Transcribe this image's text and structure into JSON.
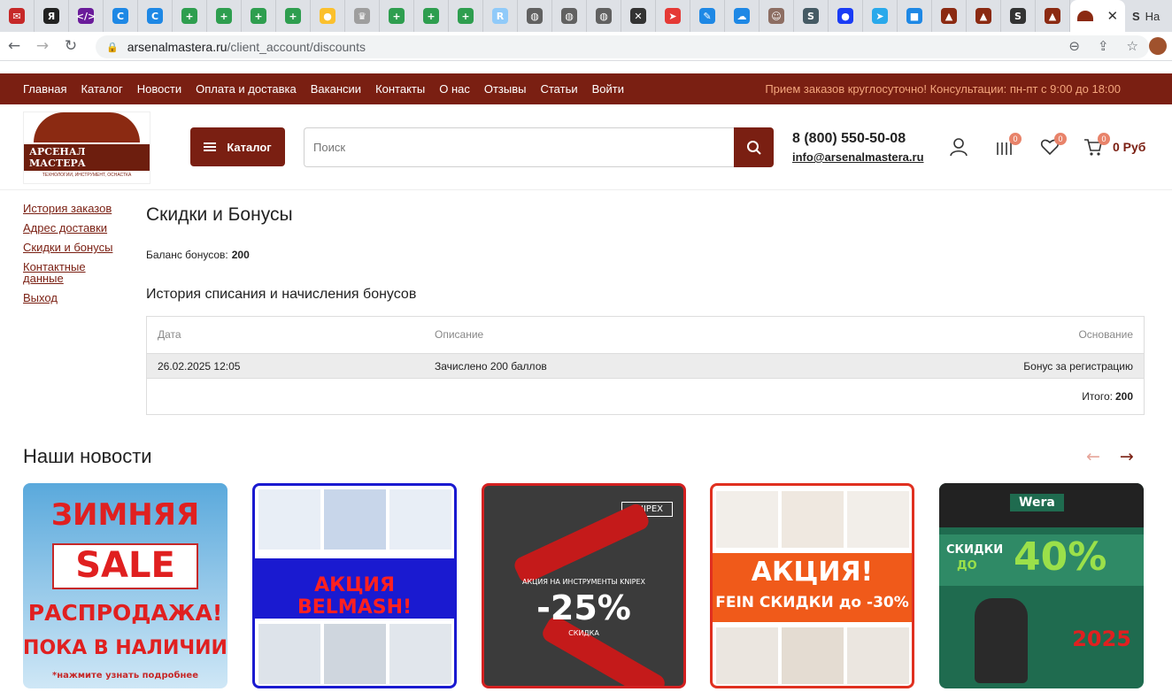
{
  "browser": {
    "tab_icons": [
      {
        "name": "yandex-mail-tab-icon",
        "color": "#c62828",
        "glyph": "✉"
      },
      {
        "name": "yandex-tab-icon",
        "color": "#222222",
        "glyph": "Я"
      },
      {
        "name": "code-tab-icon",
        "color": "#6a1b9a",
        "glyph": "</>"
      },
      {
        "name": "refresh-tab-icon",
        "color": "#1e88e5",
        "glyph": "C"
      },
      {
        "name": "refresh-tab-icon",
        "color": "#1e88e5",
        "glyph": "C"
      },
      {
        "name": "sheets-tab-icon",
        "color": "#2e9e4f",
        "glyph": "+"
      },
      {
        "name": "sheets-tab-icon",
        "color": "#2e9e4f",
        "glyph": "+"
      },
      {
        "name": "sheets-tab-icon",
        "color": "#2e9e4f",
        "glyph": "+"
      },
      {
        "name": "sheets-tab-icon",
        "color": "#2e9e4f",
        "glyph": "+"
      },
      {
        "name": "shield-tab-icon",
        "color": "#fbc02d",
        "glyph": "●"
      },
      {
        "name": "emblem-tab-icon",
        "color": "#9e9e9e",
        "glyph": "♛"
      },
      {
        "name": "sheets-tab-icon",
        "color": "#2e9e4f",
        "glyph": "+"
      },
      {
        "name": "sheets-tab-icon",
        "color": "#2e9e4f",
        "glyph": "+"
      },
      {
        "name": "sheets-tab-icon",
        "color": "#2e9e4f",
        "glyph": "+"
      },
      {
        "name": "r-tab-icon",
        "color": "#90caf9",
        "glyph": "R"
      },
      {
        "name": "globe-tab-icon",
        "color": "#616161",
        "glyph": "◍"
      },
      {
        "name": "globe-tab-icon",
        "color": "#616161",
        "glyph": "◍"
      },
      {
        "name": "globe-tab-icon",
        "color": "#616161",
        "glyph": "◍"
      },
      {
        "name": "tools-tab-icon",
        "color": "#333333",
        "glyph": "✕"
      },
      {
        "name": "plane-tab-icon",
        "color": "#e53935",
        "glyph": "➤"
      },
      {
        "name": "edit-tab-icon",
        "color": "#1e88e5",
        "glyph": "✎"
      },
      {
        "name": "cloud-tab-icon",
        "color": "#1e88e5",
        "glyph": "☁"
      },
      {
        "name": "face-tab-icon",
        "color": "#8d6e63",
        "glyph": "☺"
      },
      {
        "name": "dollar-tab-icon",
        "color": "#455a64",
        "glyph": "S"
      },
      {
        "name": "dot-tab-icon",
        "color": "#1a3cf5",
        "glyph": "●"
      },
      {
        "name": "telegram-tab-icon",
        "color": "#29a9eb",
        "glyph": "➤"
      },
      {
        "name": "chat-tab-icon",
        "color": "#1e88e5",
        "glyph": "■"
      },
      {
        "name": "arsenal-tab-icon",
        "color": "#8b2a12",
        "glyph": "▲"
      },
      {
        "name": "arsenal-tab-icon",
        "color": "#8b2a12",
        "glyph": "▲"
      },
      {
        "name": "dollar-tab-icon",
        "color": "#333333",
        "glyph": "S"
      },
      {
        "name": "arsenal-tab-icon",
        "color": "#8b2a12",
        "glyph": "▲"
      }
    ],
    "last_tab_label": "На",
    "url_host": "arsenalmastera.ru",
    "url_path": "/client_account/discounts"
  },
  "topnav": {
    "links": [
      "Главная",
      "Каталог",
      "Новости",
      "Оплата и доставка",
      "Вакансии",
      "Контакты",
      "О нас",
      "Отзывы",
      "Статьи",
      "Войти"
    ],
    "notice": "Прием заказов круглосуточно! Консультации: пн-пт с 9:00 до 18:00"
  },
  "header": {
    "logo_name": "АРСЕНАЛ МАСТЕРА",
    "logo_tagline": "ТЕХНОЛОГИИ, ИНСТРУМЕНТ, ОСНАСТКА",
    "catalog_label": "Каталог",
    "search_placeholder": "Поиск",
    "phone": "8 (800) 550-50-08",
    "email": "info@arsenalmastera.ru",
    "compare_count": "0",
    "favorites_count": "0",
    "cart_count": "0",
    "cart_sum": "0 Руб"
  },
  "sidebar": {
    "items": [
      "История заказов",
      "Адрес доставки",
      "Скидки и бонусы",
      "Контактные данные",
      "Выход"
    ]
  },
  "main": {
    "title": "Скидки и Бонусы",
    "balance_label": "Баланс бонусов:",
    "balance_value": "200",
    "history_title": "История списания и начисления бонусов",
    "table": {
      "headers": [
        "Дата",
        "Описание",
        "Основание"
      ],
      "rows": [
        [
          "26.02.2025 12:05",
          "Зачислено 200 баллов",
          "Бонус за регистрацию"
        ]
      ],
      "total_label": "Итого:",
      "total_value": "200"
    }
  },
  "news": {
    "title": "Наши новости",
    "cards": [
      {
        "line1": "ЗИМНЯЯ",
        "line2": "SALE",
        "line3": "РАСПРОДАЖА!",
        "line4": "ПОКА В НАЛИЧИИ",
        "line5": "*нажмите узнать подробнее"
      },
      {
        "line1": "АКЦИЯ BELMASH!"
      },
      {
        "line1": "KNIPEX",
        "line2": "АКЦИЯ НА ИНСТРУМЕНТЫ KNIPEX",
        "line3": "-25%",
        "line4": "СКИДКА"
      },
      {
        "line1": "АКЦИЯ!",
        "line2": "FEIN СКИДКИ до -30%"
      },
      {
        "line1": "Wera",
        "line2": "СКИДКИ",
        "line3": "ДО",
        "line4": "40%",
        "line5": "2025"
      }
    ]
  },
  "colors": {
    "brand": "#7a1f12",
    "notice": "#f4a67d",
    "badge": "#e8836a"
  }
}
